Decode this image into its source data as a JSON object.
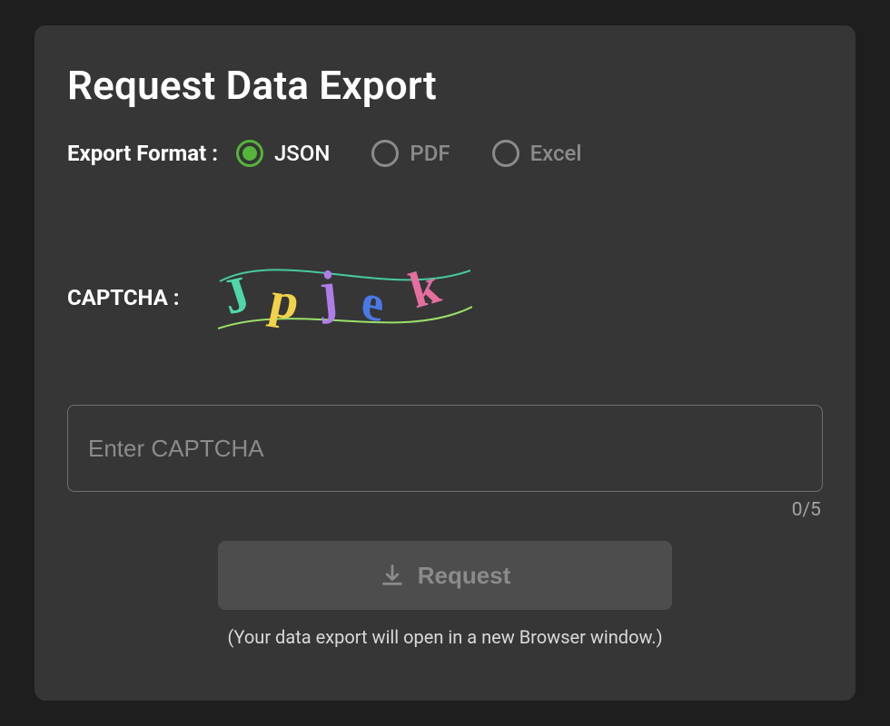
{
  "title": "Request Data Export",
  "format": {
    "label": "Export Format :",
    "options": [
      {
        "key": "json",
        "label": "JSON",
        "selected": true
      },
      {
        "key": "pdf",
        "label": "PDF",
        "selected": false
      },
      {
        "key": "excel",
        "label": "Excel",
        "selected": false
      }
    ]
  },
  "captcha": {
    "label": "CAPTCHA :",
    "glyphs": [
      "J",
      "p",
      "j",
      "e",
      "k"
    ],
    "glyph_colors": [
      "#4fd7a8",
      "#f2d24a",
      "#b07de8",
      "#4a78e6",
      "#e56fa0"
    ],
    "input_placeholder": "Enter CAPTCHA",
    "input_value": "",
    "counter": "0/5",
    "max_length": 5
  },
  "action": {
    "button_label": "Request",
    "hint": "(Your data export will open in a new Browser window.)"
  },
  "colors": {
    "accent_green": "#55b43a"
  }
}
